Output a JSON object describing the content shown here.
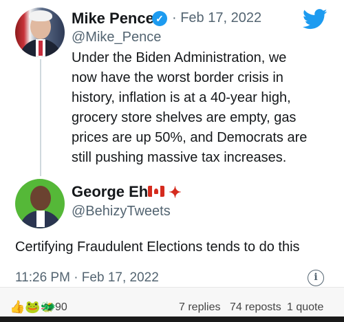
{
  "original_tweet": {
    "author_name": "Mike Pence",
    "handle": "@Mike_Pence",
    "date": "· Feb 17, 2022",
    "lines": [
      "Under the Biden Administration, we",
      "now have the worst border crisis in",
      "history, inflation is at a 40-year high,",
      "grocery store shelves are empty, gas",
      "prices are up 50%, and Democrats are",
      "still pushing massive tax increases."
    ]
  },
  "reply_tweet": {
    "author_name": "George Eh",
    "handle": "@BehizyTweets",
    "text": "Certifying Fraudulent Elections tends to do this",
    "timestamp": "11:26 PM · Feb 17, 2022"
  },
  "footer": {
    "reaction_count": "90",
    "replies": "7 replies",
    "reposts": "74 reposts",
    "quotes": "1 quote"
  },
  "icons": {
    "verified": "verified-badge-icon",
    "brand": "twitter-bird-icon",
    "info": "info-icon",
    "reactions": "reaction-emoji-icons"
  },
  "colors": {
    "twitter_blue": "#1d9bf0",
    "secondary_text": "#536471"
  }
}
